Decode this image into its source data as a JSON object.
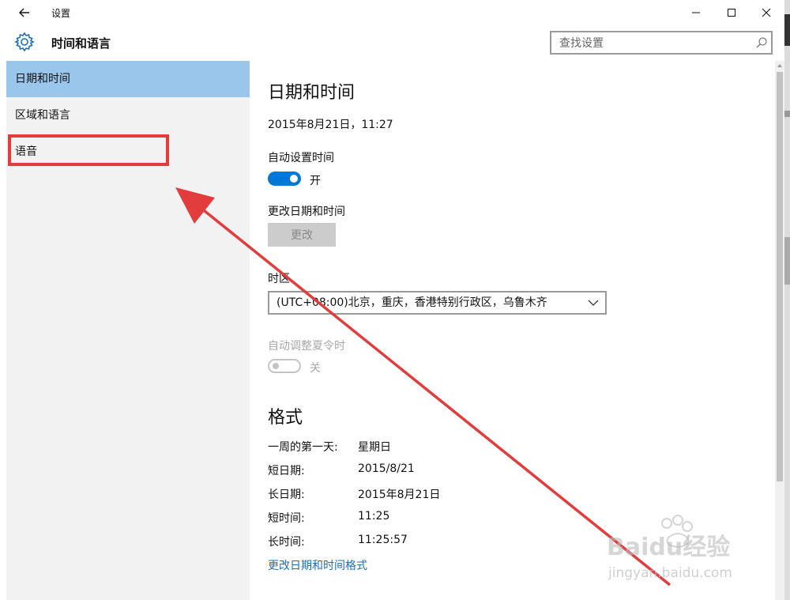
{
  "window": {
    "title": "设置",
    "page_title": "时间和语言"
  },
  "search": {
    "placeholder": "查找设置"
  },
  "sidebar": {
    "items": [
      {
        "label": "日期和时间",
        "active": true
      },
      {
        "label": "区域和语言",
        "active": false
      },
      {
        "label": "语音",
        "active": false
      }
    ]
  },
  "content": {
    "section_title": "日期和时间",
    "current_datetime": "2015年8月21日，11:27",
    "auto_time_label": "自动设置时间",
    "auto_time_state": "开",
    "change_datetime_label": "更改日期和时间",
    "change_button": "更改",
    "timezone_label": "时区",
    "timezone_value": "(UTC+08:00)北京，重庆，香港特别行政区，乌鲁木齐",
    "dst_label": "自动调整夏令时",
    "dst_state": "关",
    "format_title": "格式",
    "format_rows": [
      {
        "key": "一周的第一天:",
        "value": "星期日"
      },
      {
        "key": "短日期:",
        "value": "2015/8/21"
      },
      {
        "key": "长日期:",
        "value": "2015年8月21日"
      },
      {
        "key": "短时间:",
        "value": "11:25"
      },
      {
        "key": "长时间:",
        "value": "11:25:57"
      }
    ],
    "format_link": "更改日期和时间格式"
  },
  "colors": {
    "accent": "#0078d7",
    "active_nav": "#9bc6eb",
    "annotation": "#e23c3c",
    "link": "#1a6fb0"
  },
  "watermark": {
    "brand": "Baidu经验",
    "url": "jingyan.baidu.com"
  },
  "icons": {
    "back": "back-arrow-icon",
    "settings": "gear-icon",
    "search": "search-icon",
    "minimize": "minimize-icon",
    "maximize": "maximize-icon",
    "close": "close-icon",
    "dropdown": "chevron-down-icon"
  }
}
